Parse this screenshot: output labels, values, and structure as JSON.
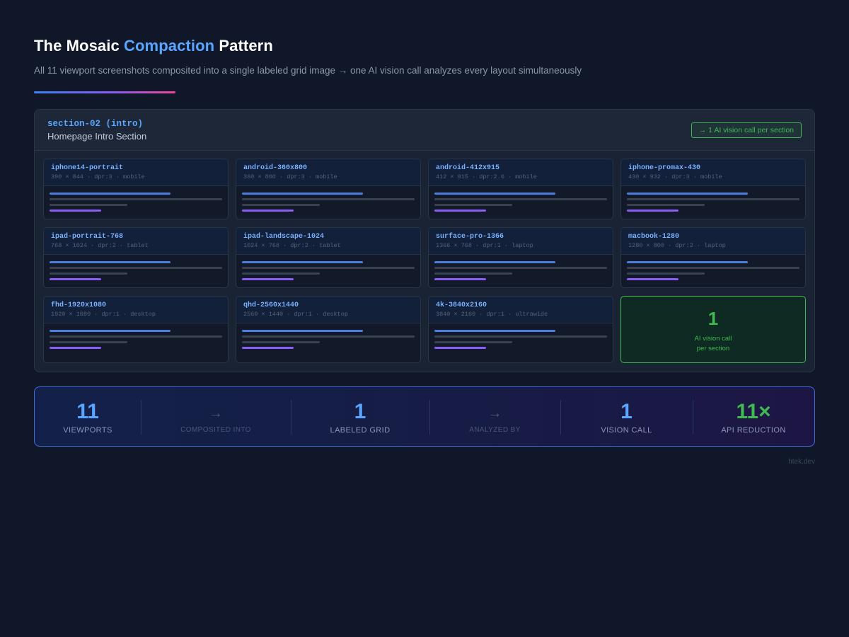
{
  "header": {
    "title_pre": "The Mosaic ",
    "title_accent": "Compaction",
    "title_post": " Pattern",
    "subtitle": "All 11 viewport screenshots composited into a single labeled grid image → one AI vision call analyzes every layout simultaneously"
  },
  "section": {
    "id": "section-02 (intro)",
    "name": "Homepage Intro Section",
    "badge": "→ 1 AI vision call per section"
  },
  "viewports": [
    {
      "name": "iphone14-portrait",
      "meta": "390 × 844 · dpr:3 · mobile"
    },
    {
      "name": "android-360x800",
      "meta": "360 × 800 · dpr:3 · mobile"
    },
    {
      "name": "android-412x915",
      "meta": "412 × 915 · dpr:2.6 · mobile"
    },
    {
      "name": "iphone-promax-430",
      "meta": "430 × 932 · dpr:3 · mobile"
    },
    {
      "name": "ipad-portrait-768",
      "meta": "768 × 1024 · dpr:2 · tablet"
    },
    {
      "name": "ipad-landscape-1024",
      "meta": "1024 × 768 · dpr:2 · tablet"
    },
    {
      "name": "surface-pro-1366",
      "meta": "1366 × 768 · dpr:1 · laptop"
    },
    {
      "name": "macbook-1280",
      "meta": "1280 × 800 · dpr:2 · laptop"
    },
    {
      "name": "fhd-1920x1080",
      "meta": "1920 × 1080 · dpr:1 · desktop"
    },
    {
      "name": "qhd-2560x1440",
      "meta": "2560 × 1440 · dpr:1 · desktop"
    },
    {
      "name": "4k-3840x2160",
      "meta": "3840 × 2160 · dpr:1 · ultrawide"
    }
  ],
  "summary": {
    "number": "1",
    "line1": "AI vision call",
    "line2": "per section"
  },
  "flow": [
    {
      "kind": "stat",
      "value": "11",
      "label": "VIEWPORTS"
    },
    {
      "kind": "arrow",
      "value": "→",
      "label": "COMPOSITED INTO"
    },
    {
      "kind": "stat",
      "value": "1",
      "label": "LABELED GRID"
    },
    {
      "kind": "arrow",
      "value": "→",
      "label": "ANALYZED BY"
    },
    {
      "kind": "stat",
      "value": "1",
      "label": "VISION CALL"
    },
    {
      "kind": "stat",
      "value": "11×",
      "label": "API REDUCTION"
    }
  ],
  "footer": "htek.dev",
  "colors": {
    "background": "#0f1729",
    "accent_blue": "#58a6ff",
    "accent_green": "#3fb950",
    "accent_purple": "#8b5cf6"
  }
}
